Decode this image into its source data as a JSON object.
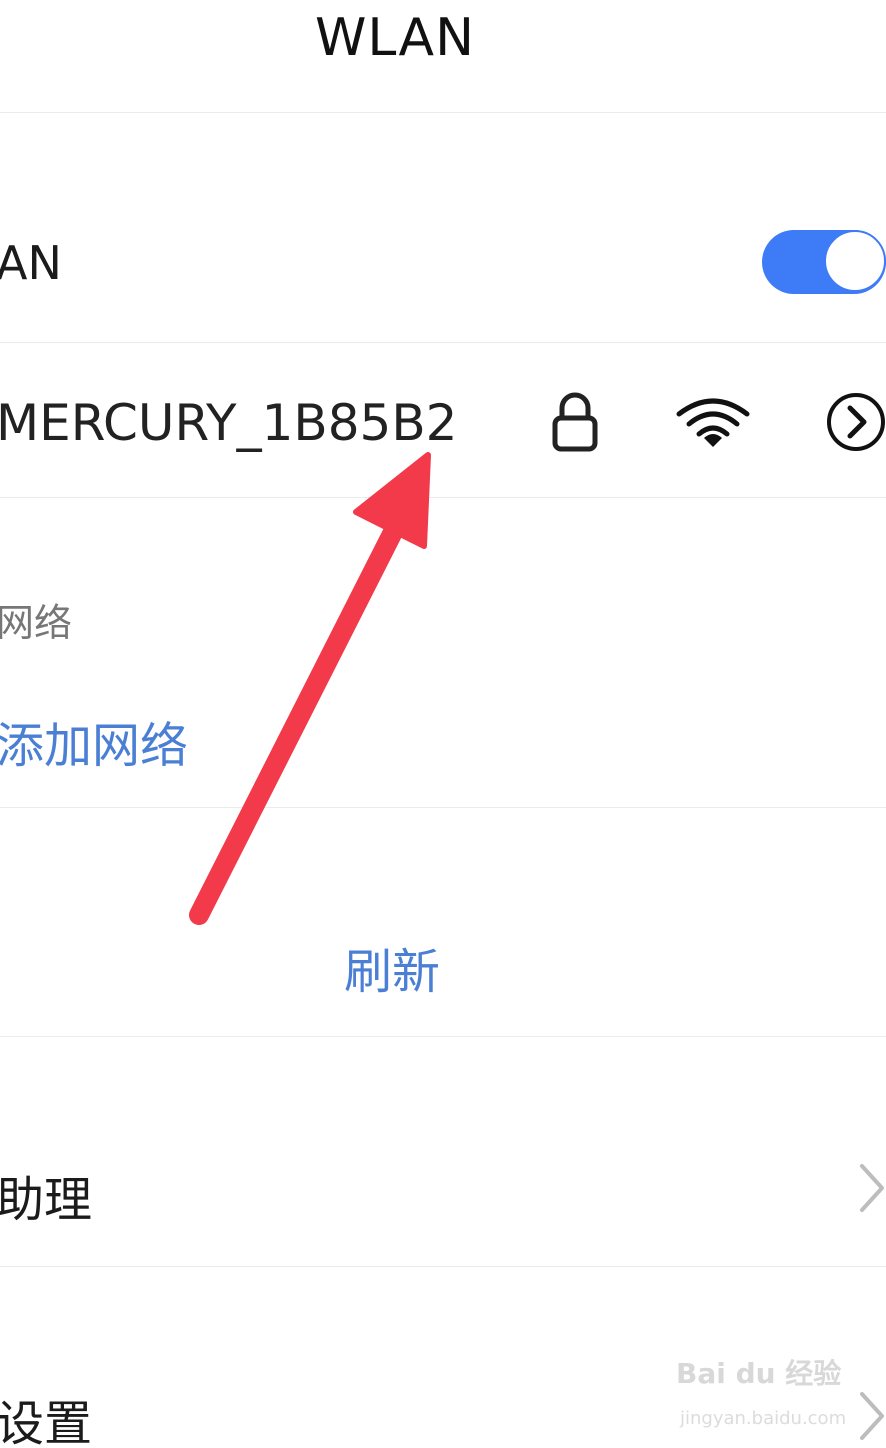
{
  "header": {
    "title": "WLAN"
  },
  "wlan_toggle": {
    "label": "AN",
    "state": "on",
    "accent_color": "#3d7bf7"
  },
  "connected_network": {
    "ssid": "MERCURY_1B85B2",
    "icons": [
      "lock-icon",
      "wifi-signal-icon",
      "chevron-right-circle-icon"
    ]
  },
  "other_networks": {
    "section_label": "网络",
    "add_network_label": "添加网络"
  },
  "refresh": {
    "label": "刷新"
  },
  "assistant": {
    "label": "助理",
    "icon": "chevron-right-icon"
  },
  "settings": {
    "label": "设置",
    "icon": "chevron-right-icon"
  },
  "annotation": {
    "color": "#f23a4b",
    "icon": "red-arrow-annotation"
  },
  "watermark": {
    "main": "Bai du 经验",
    "sub": "jingyan.baidu.com"
  }
}
